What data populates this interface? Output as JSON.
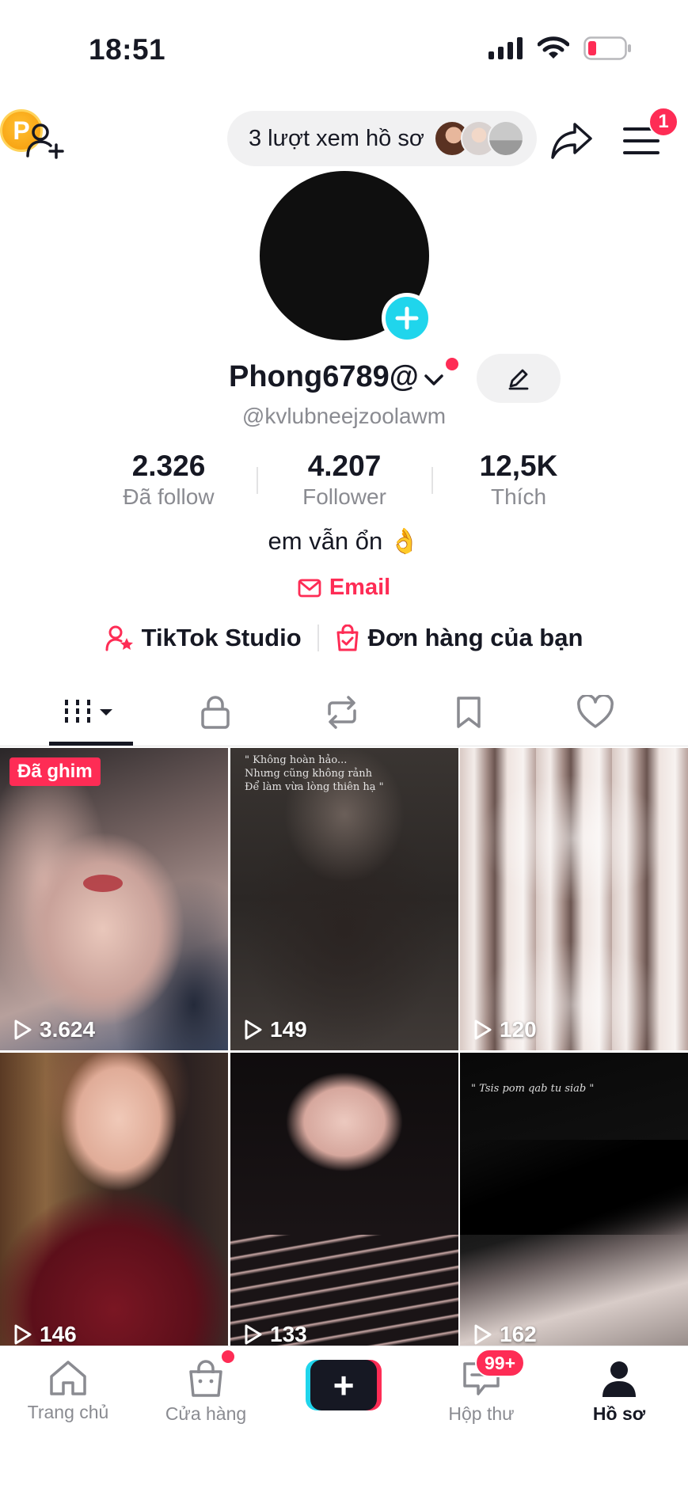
{
  "status_bar": {
    "time": "18:51",
    "icons": [
      "signal-icon",
      "wifi-icon",
      "battery-icon"
    ]
  },
  "top_bar": {
    "profile_views": "3 lượt xem hồ sơ",
    "menu_badge": "1",
    "coin_letter": "P"
  },
  "profile": {
    "display_name": "Phong6789@",
    "username": "@kvlubneejzoolawm",
    "bio": "em vẫn ổn 👌",
    "email_label": "Email"
  },
  "stats": [
    {
      "value": "2.326",
      "label": "Đã follow"
    },
    {
      "value": "4.207",
      "label": "Follower"
    },
    {
      "value": "12,5K",
      "label": "Thích"
    }
  ],
  "links": {
    "studio": "TikTok Studio",
    "orders": "Đơn hàng của bạn"
  },
  "tabs": [
    "videos",
    "private",
    "reposts",
    "favorites",
    "liked"
  ],
  "videos": [
    {
      "views": "3.624",
      "pinned_label": "Đã ghim"
    },
    {
      "views": "149",
      "caption": "\" Không hoàn hảo...\nNhưng cũng không rảnh\nĐể làm vừa lòng thiên hạ \""
    },
    {
      "views": "120"
    },
    {
      "views": "146"
    },
    {
      "views": "133"
    },
    {
      "views": "162",
      "caption": "\" Tsis pom qab tu siab \""
    }
  ],
  "bottom_nav": {
    "home": "Trang chủ",
    "shop": "Cửa hàng",
    "create": "+",
    "inbox": "Hộp thư",
    "inbox_badge": "99+",
    "profile": "Hồ sơ"
  },
  "colors": {
    "accent": "#fe2c55",
    "cyan": "#20d5ec",
    "text": "#161823",
    "muted": "#8a8b91"
  }
}
